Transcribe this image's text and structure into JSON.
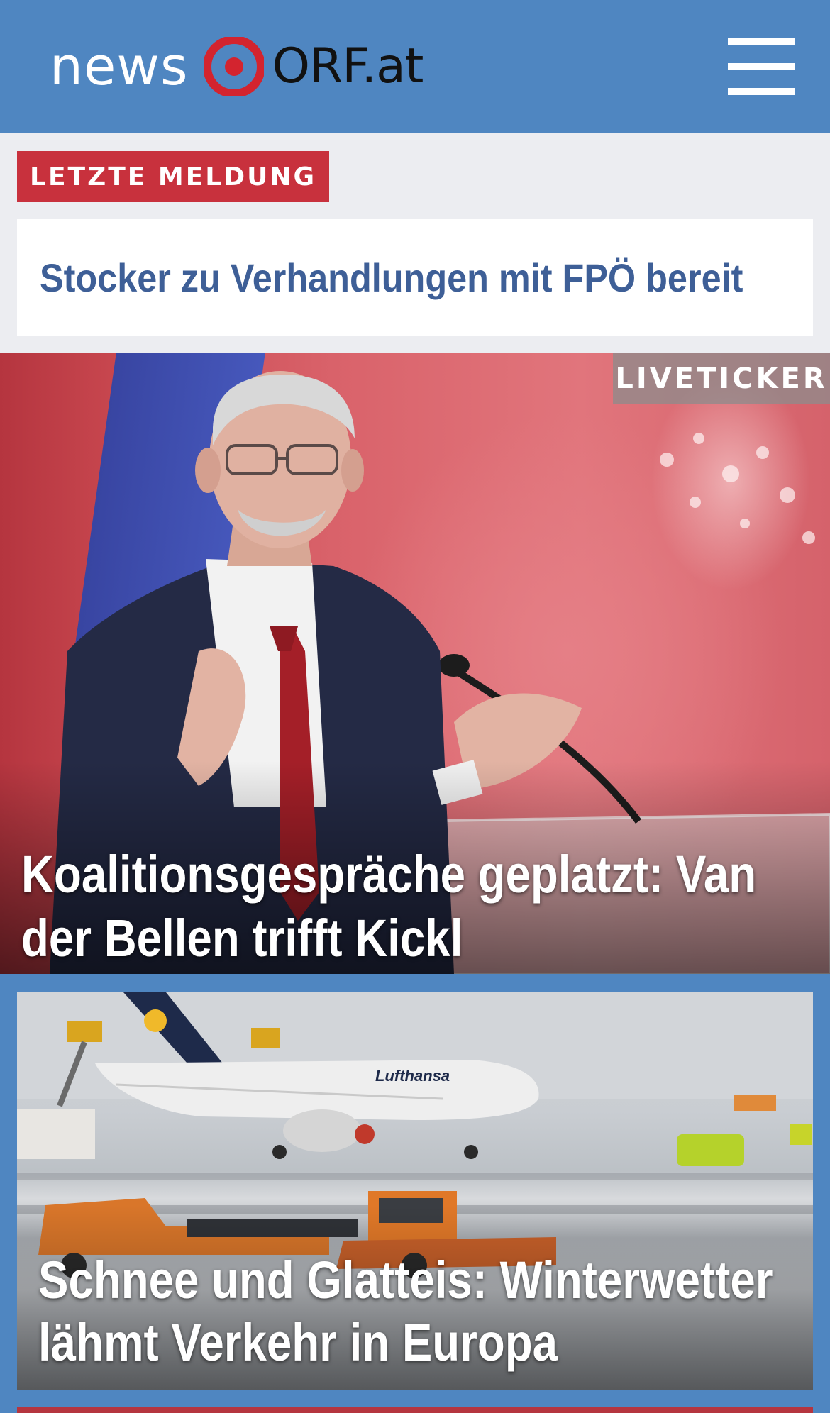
{
  "header": {
    "logo_news": "news",
    "logo_orf": "ORF.at",
    "menu_icon": "hamburger-menu-icon",
    "logo_icon": "orf-target-logo-icon"
  },
  "breaking": {
    "badge": "LETZTE MELDUNG",
    "headline": "Stocker zu Verhandlungen mit FPÖ bereit"
  },
  "hero": {
    "tag": "LIVETICKER",
    "headline": "Koalitionsgespräche geplatzt: Van der Bellen trifft Kickl"
  },
  "story2": {
    "headline": "Schnee und Glatteis: Winterwetter lähmt Verkehr in Europa",
    "plane_text": "Lufthansa"
  },
  "colors": {
    "header_blue": "#4f86c1",
    "badge_red": "#c8313d",
    "headline_blue": "#3e5f97",
    "page_bg": "#ecedf1"
  }
}
